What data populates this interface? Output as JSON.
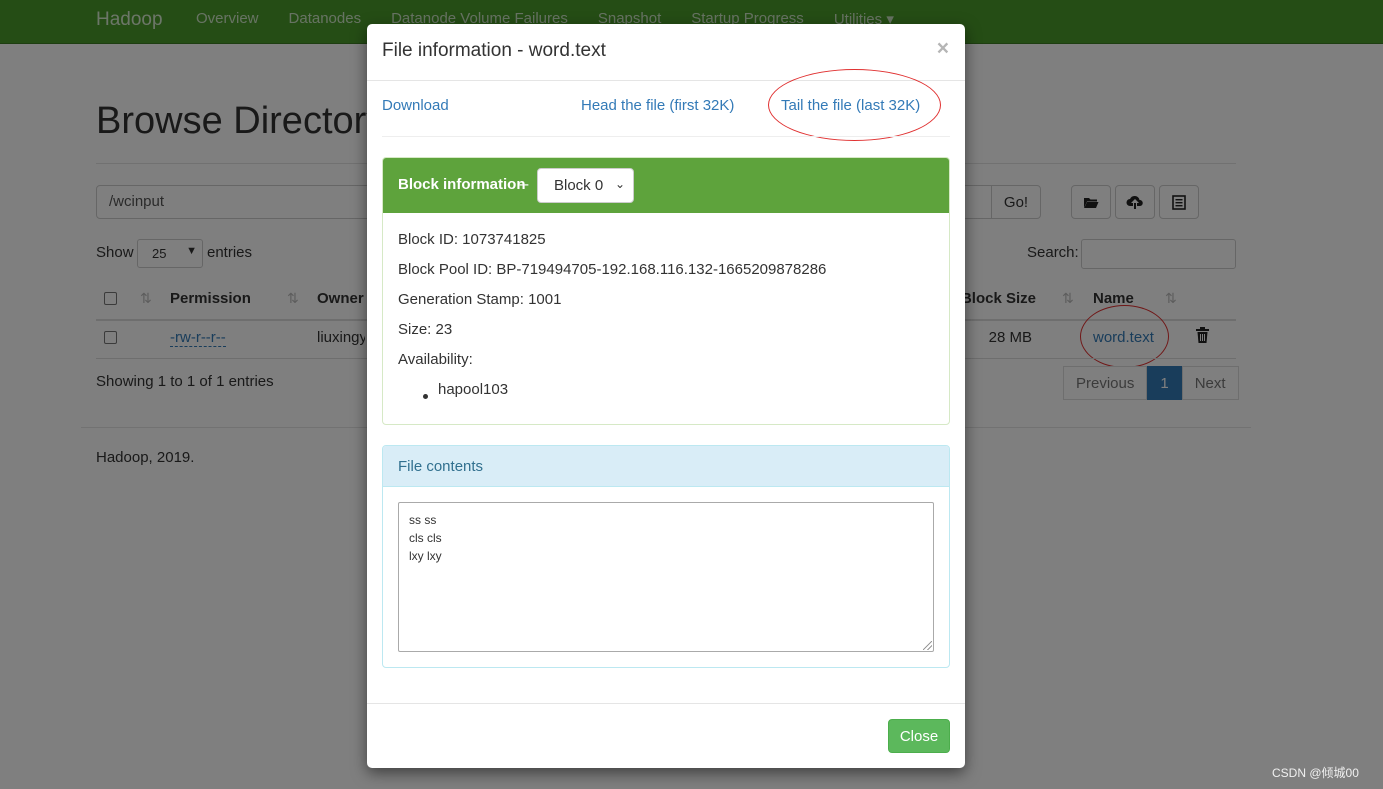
{
  "navbar": {
    "brand": "Hadoop",
    "items": [
      "Overview",
      "Datanodes",
      "Datanode Volume Failures",
      "Snapshot",
      "Startup Progress",
      "Utilities ▾"
    ]
  },
  "page": {
    "title": "Browse Directory",
    "path_value": "/wcinput",
    "go_label": "Go!",
    "show_label": "Show",
    "page_size": "25",
    "entries_label": "entries",
    "search_label": "Search:",
    "columns": [
      "Permission",
      "Owner",
      "Block Size",
      "Name"
    ],
    "row": {
      "permission": "-rw-r--r--",
      "owner": "liuxingy",
      "block_size": "28 MB",
      "name": "word.text"
    },
    "info": "Showing 1 to 1 of 1 entries",
    "pager": {
      "previous": "Previous",
      "current": "1",
      "next": "Next"
    },
    "footer": "Hadoop, 2019."
  },
  "modal": {
    "title": "File information - word.text",
    "close_x": "×",
    "links": {
      "download": "Download",
      "head": "Head the file (first 32K)",
      "tail": "Tail the file (last 32K)"
    },
    "block_panel": {
      "title": "Block information",
      "separator": "--",
      "selected_block": "Block 0",
      "block_id": "Block ID: 1073741825",
      "block_pool_id": "Block Pool ID: BP-719494705-192.168.116.132-1665209878286",
      "generation_stamp": "Generation Stamp: 1001",
      "size": "Size: 23",
      "availability_label": "Availability:",
      "availability_hosts": [
        "hapool103"
      ]
    },
    "contents_panel": {
      "title": "File contents",
      "lines": [
        "ss ss",
        "cls cls",
        "lxy lxy"
      ]
    },
    "close_button": "Close"
  },
  "watermark": "CSDN @倾城00",
  "colors": {
    "navbar": "#4a9a2a",
    "block_panel_header": "#5ea33c",
    "contents_panel_header": "#d9edf7",
    "link": "#337ab7",
    "close_button": "#5cb85c",
    "annotation_circle": "#e03030"
  }
}
